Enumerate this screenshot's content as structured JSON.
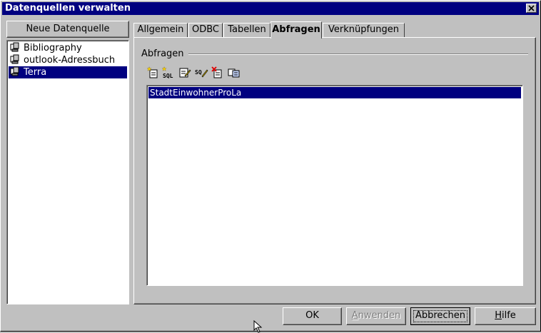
{
  "window": {
    "title": "Datenquellen verwalten"
  },
  "sources": {
    "new_button": "Neue Datenquelle",
    "items": [
      {
        "label": "Bibliography",
        "icon": "database-icon",
        "selected": false
      },
      {
        "label": "outlook-Adressbuch",
        "icon": "database-icon",
        "selected": false
      },
      {
        "label": "Terra",
        "icon": "database-icon",
        "selected": true
      }
    ]
  },
  "tabs": [
    {
      "label": "Allgemein",
      "active": false
    },
    {
      "label": "ODBC",
      "active": false
    },
    {
      "label": "Tabellen",
      "active": false
    },
    {
      "label": "Abfragen",
      "active": true
    },
    {
      "label": "Verknüpfungen",
      "active": false
    }
  ],
  "queries": {
    "group_label": "Abfragen",
    "toolbar": [
      {
        "name": "new-query-icon"
      },
      {
        "name": "new-sql-query-icon"
      },
      {
        "name": "edit-query-icon"
      },
      {
        "name": "edit-sql-query-icon"
      },
      {
        "name": "delete-query-icon"
      },
      {
        "name": "copy-query-icon"
      }
    ],
    "items": [
      {
        "label": "StadtEinwohnerProLa",
        "selected": true
      }
    ]
  },
  "buttons": {
    "ok": "OK",
    "apply": {
      "before": "",
      "mnemonic": "A",
      "after": "nwenden"
    },
    "cancel": "Abbrechen",
    "help": {
      "before": "",
      "mnemonic": "H",
      "after": "ilfe"
    }
  },
  "colors": {
    "titlebar": "#000080",
    "selection": "#000080",
    "face": "#c0c0c0"
  }
}
